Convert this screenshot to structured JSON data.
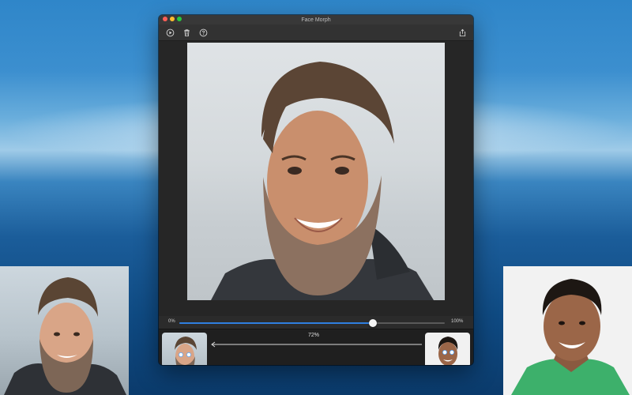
{
  "window": {
    "title": "Face Morph"
  },
  "toolbar": {
    "buttons": [
      {
        "name": "play-button",
        "icon": "play-circle-icon"
      },
      {
        "name": "delete-button",
        "icon": "trash-icon"
      },
      {
        "name": "help-button",
        "icon": "help-circle-icon"
      },
      {
        "name": "export-button",
        "icon": "share-icon"
      }
    ]
  },
  "slider": {
    "min_label": "0%",
    "max_label": "100%",
    "value_fraction": 0.73
  },
  "morph": {
    "percent_label": "72%",
    "direction": "right-to-left"
  },
  "colors": {
    "accent": "#2f7fe0",
    "window_bg": "#2b2b2b",
    "bottom_bar": "#1f1f1f"
  }
}
